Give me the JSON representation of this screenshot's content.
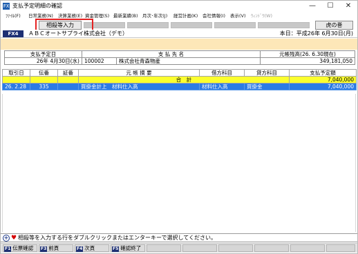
{
  "window": {
    "title": "支払予定明細の確認",
    "minimize_glyph": "—",
    "maximize_glyph": "☐",
    "close_glyph": "✕"
  },
  "menu": {
    "items": [
      {
        "label": "ﾌｧｲﾙ(F)",
        "enabled": true
      },
      {
        "label": "日常業務(N)",
        "enabled": true
      },
      {
        "label": "決算業務(E)",
        "enabled": true
      },
      {
        "label": "資金管理(S)",
        "enabled": true
      },
      {
        "label": "最新業績(B)",
        "enabled": true
      },
      {
        "label": "月次･年次(J)",
        "enabled": true
      },
      {
        "label": "経営計画(K)",
        "enabled": true
      },
      {
        "label": "会社情報(I)",
        "enabled": true
      },
      {
        "label": "表示(V)",
        "enabled": true
      },
      {
        "label": "ｳｨﾝﾄﾞｳ(W)",
        "enabled": false
      }
    ]
  },
  "toolbar": {
    "left_button": "相殺等入力",
    "right_button": "虎の巻"
  },
  "company": {
    "badge": "FX4",
    "name": "ＡＢＣオートサプライ株式会社（デモ）",
    "today": "本日：平成26年 6月30日(月)"
  },
  "info_table": {
    "headers": {
      "date": "支払予定日",
      "payee": "支 払 先 名",
      "balance": "元帳残高(26. 6.30現在)"
    },
    "row": {
      "date": "26年 4月30日(水)",
      "code": "100002",
      "payee": "株式会社青森物産",
      "balance": "349,181,050"
    }
  },
  "detail_table": {
    "headers": [
      "取引日",
      "伝番",
      "証番",
      "元 帳 摘 要",
      "借方科目",
      "貸方科目",
      "支払予定額"
    ],
    "total_row": {
      "label": "合　計",
      "amount": "7,040,000"
    },
    "rows": [
      {
        "date": "26. 2.28",
        "voucher": "335",
        "proof": "",
        "memo": "買掛金計上　材料仕入高",
        "debit": "材料仕入高",
        "credit": "買掛金",
        "amount": "7,040,000"
      }
    ]
  },
  "status": {
    "icon": "info-icon",
    "message": "相殺等を入力する行をダブルクリックまたはエンターキーで選択してください。"
  },
  "fkeys": [
    {
      "key": "F1",
      "label": "伝票確認"
    },
    {
      "key": "F3",
      "label": "前頁"
    },
    {
      "key": "F4",
      "label": "次頁"
    },
    {
      "key": "F5",
      "label": "確認終了"
    }
  ]
}
